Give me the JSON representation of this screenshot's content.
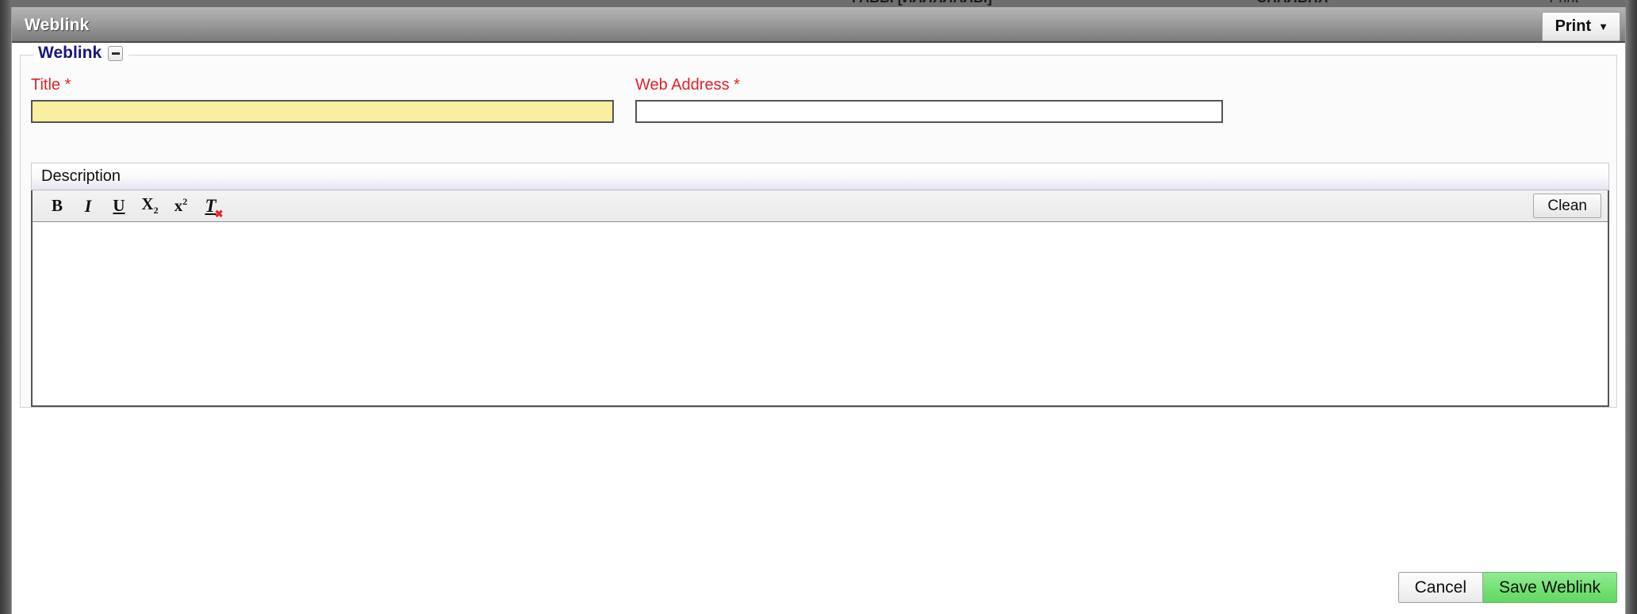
{
  "background": {
    "clipped_text_left": "ГАВЫ [ИЛЛЯЛАЛЫ]",
    "clipped_text_mid": "СПАЛЬНЯ",
    "clipped_text_right": "Print"
  },
  "titlebar": {
    "title": "Weblink",
    "print_label": "Print",
    "print_caret": "▼"
  },
  "fieldset": {
    "legend": "Weblink",
    "collapse_icon": "minus-icon"
  },
  "fields": {
    "title": {
      "label": "Title",
      "required_marker": "*",
      "value": "",
      "placeholder": ""
    },
    "web_address": {
      "label": "Web Address",
      "required_marker": "*",
      "value": "",
      "placeholder": ""
    }
  },
  "description": {
    "header": "Description",
    "toolbar": {
      "bold": "B",
      "italic": "I",
      "underline": "U",
      "subscript_base": "X",
      "subscript_small": "2",
      "superscript_base": "x",
      "superscript_small": "2",
      "remove_format": "T",
      "remove_format_mark": "✖",
      "clean_label": "Clean"
    },
    "body_value": ""
  },
  "footer": {
    "cancel_label": "Cancel",
    "save_label": "Save Weblink"
  },
  "colors": {
    "required_label": "#e0222a",
    "legend": "#17177e",
    "focused_input": "#faeea0",
    "save_button": "#74e074",
    "titlebar_top": "#b4b4b4",
    "titlebar_bottom": "#7c7c7c"
  }
}
